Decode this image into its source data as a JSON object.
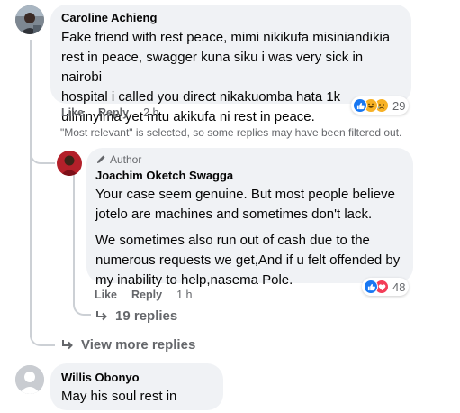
{
  "comments": [
    {
      "author": "Caroline Achieng",
      "lines": [
        "Fake friend with rest peace, mimi nikikufa misiniandikia",
        "rest in peace, swagger kuna siku i was very sick in nairobi",
        "hospital i called you direct nikakuomba hata 1k",
        "ulininyima yet mtu akikufa ni rest in peace."
      ],
      "like_label": "Like",
      "reply_label": "Reply",
      "time": "2 h",
      "reaction_count": "29"
    }
  ],
  "filter_note": "\"Most relevant\" is selected, so some replies may have been filtered out.",
  "reply": {
    "badge": "Author",
    "author": "Joachim Oketch Swagga",
    "para1": [
      "Your case seem genuine. But most people believe",
      "jotelo are machines and sometimes don't lack."
    ],
    "para2": [
      "We sometimes also run out of cash due to the",
      "numerous requests we get,And if u felt offended by",
      "my inability to help,nasema Pole."
    ],
    "like_label": "Like",
    "reply_label": "Reply",
    "time": "1 h",
    "reaction_count": "48",
    "replies_link": "19 replies"
  },
  "view_more": "View more replies",
  "comment2": {
    "author": "Willis Obonyo",
    "text": "May his soul rest in peace"
  },
  "colors": {
    "bubble": "#f0f2f5",
    "meta": "#65676b",
    "like_blue": "#1877f2",
    "love_red": "#f33e58",
    "haha_yellow": "#f7b125"
  },
  "icons": [
    "like-icon",
    "haha-icon",
    "sad-icon",
    "love-icon",
    "pencil-icon",
    "reply-arrow-icon"
  ]
}
